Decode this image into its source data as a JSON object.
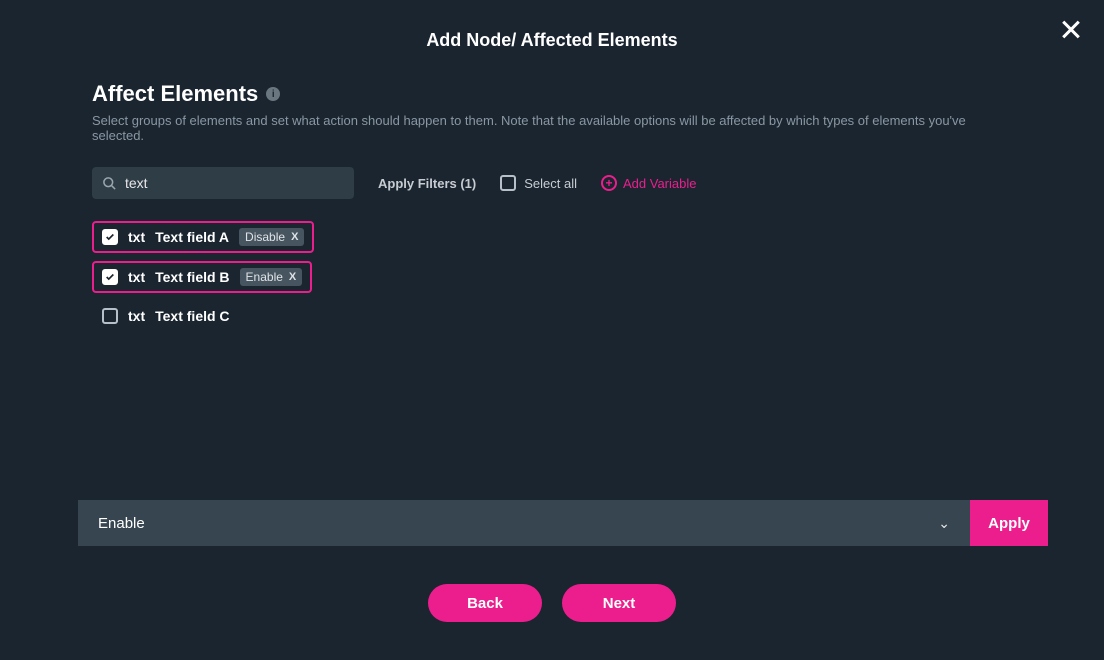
{
  "header": {
    "title": "Add Node/ Affected Elements"
  },
  "section": {
    "heading": "Affect Elements",
    "description": "Select groups of elements and set what action should happen to them. Note that the available options will be affected by which types of elements you've selected."
  },
  "filter": {
    "search_value": "text",
    "apply_filters_label": "Apply Filters (1)",
    "select_all_label": "Select all",
    "add_variable_label": "Add Variable"
  },
  "items": [
    {
      "checked": true,
      "highlighted": true,
      "prefix": "txt",
      "label": "Text field A",
      "action": "Disable"
    },
    {
      "checked": true,
      "highlighted": true,
      "prefix": "txt",
      "label": "Text field B",
      "action": "Enable"
    },
    {
      "checked": false,
      "highlighted": false,
      "prefix": "txt",
      "label": "Text field C",
      "action": null
    }
  ],
  "apply_footer": {
    "selected_action": "Enable",
    "apply_label": "Apply"
  },
  "nav": {
    "back_label": "Back",
    "next_label": "Next"
  }
}
